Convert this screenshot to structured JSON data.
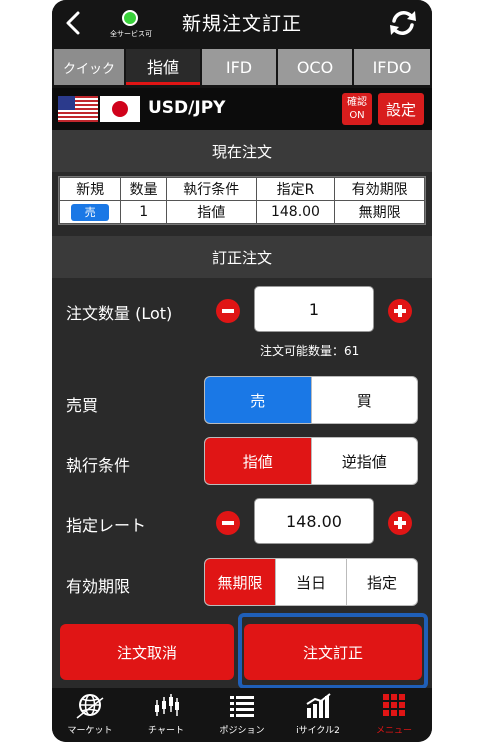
{
  "header": {
    "title": "新規注文訂正",
    "status_label": "全サービス可",
    "status_color": "#39d13a",
    "back_icon": "chevron-left-icon",
    "refresh_icon": "refresh-icon"
  },
  "tabs": [
    {
      "label": "クイック",
      "active": false
    },
    {
      "label": "指値",
      "active": true
    },
    {
      "label": "IFD",
      "active": false
    },
    {
      "label": "OCO",
      "active": false
    },
    {
      "label": "IFDO",
      "active": false
    }
  ],
  "pair": {
    "symbol": "USD/JPY",
    "confirm_label_line1": "確認",
    "confirm_label_line2": "ON",
    "settings_label": "設定"
  },
  "current_order": {
    "header": "現在注文",
    "columns": [
      "新規",
      "数量",
      "執行条件",
      "指定R",
      "有効期限"
    ],
    "row": {
      "side": "売",
      "quantity": "1",
      "condition": "指値",
      "rate": "148.00",
      "expiry": "無期限"
    }
  },
  "amend": {
    "header": "訂正注文",
    "quantity_label": "注文数量 (Lot)",
    "quantity_value": "1",
    "available_text": "注文可能数量：61",
    "side_label": "売買",
    "side_options": [
      "売",
      "買"
    ],
    "side_selected": "売",
    "condition_label": "執行条件",
    "condition_options": [
      "指値",
      "逆指値"
    ],
    "condition_selected": "指値",
    "rate_label": "指定レート",
    "rate_value": "148.00",
    "expiry_label": "有効期限",
    "expiry_options": [
      "無期限",
      "当日",
      "指定"
    ],
    "expiry_selected": "無期限"
  },
  "actions": {
    "cancel_label": "注文取消",
    "amend_label": "注文訂正"
  },
  "nav": [
    {
      "label": "マーケット",
      "icon": "globe-icon"
    },
    {
      "label": "チャート",
      "icon": "candlestick-icon"
    },
    {
      "label": "ポジション",
      "icon": "list-icon"
    },
    {
      "label": "iサイクル2",
      "icon": "bar-chart-icon"
    },
    {
      "label": "メニュー",
      "icon": "grid-menu-icon",
      "active": true
    }
  ],
  "colors": {
    "accent_red": "#e01515",
    "sell_blue": "#1a78e6",
    "highlight_border": "#1f5fb8"
  }
}
